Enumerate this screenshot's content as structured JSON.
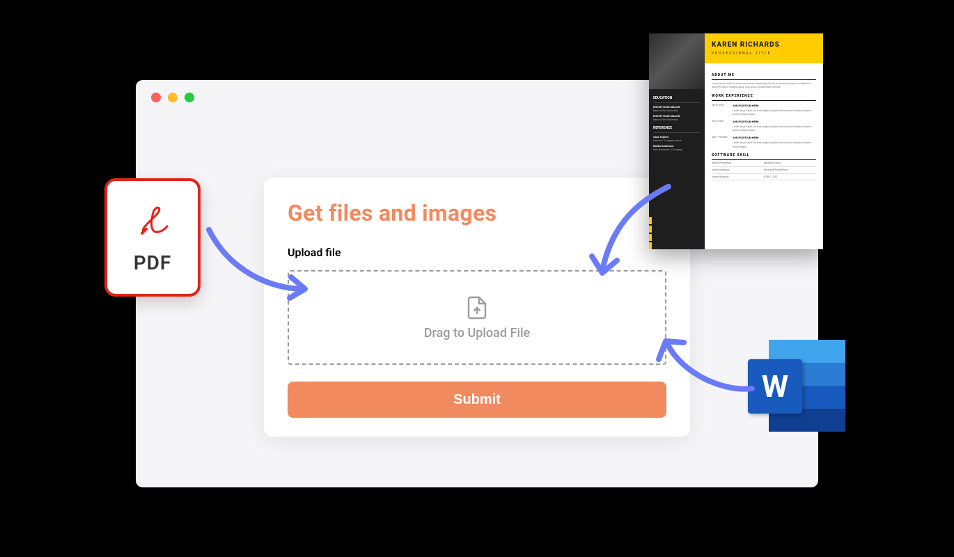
{
  "card": {
    "title": "Get files and images",
    "upload_label": "Upload file",
    "dropzone_text": "Drag to Upload File",
    "submit_label": "Submit"
  },
  "filetypes": {
    "pdf_label": "PDF",
    "word_label": "W"
  },
  "resume": {
    "name": "KAREN RICHARDS",
    "subtitle": "PROFESSIONAL TITLE",
    "sections": {
      "about": "ABOUT ME",
      "work": "WORK EXPERIENCE",
      "skills": "SOFTWARE SKILL",
      "education": "EDUCATION",
      "reference": "REFERENCE"
    },
    "education": [
      {
        "degree": "ENTER YOUR MAJOR",
        "sub": "Name of the University"
      },
      {
        "degree": "ENTER YOUR MAJOR",
        "sub": "Name of the University"
      }
    ],
    "work_dates": [
      "2018–2019",
      "2019–2021",
      "2021–Present"
    ],
    "work_titles": [
      "JOB POSITION HERE",
      "JOB POSITION HERE",
      "JOB POSITION HERE"
    ]
  }
}
